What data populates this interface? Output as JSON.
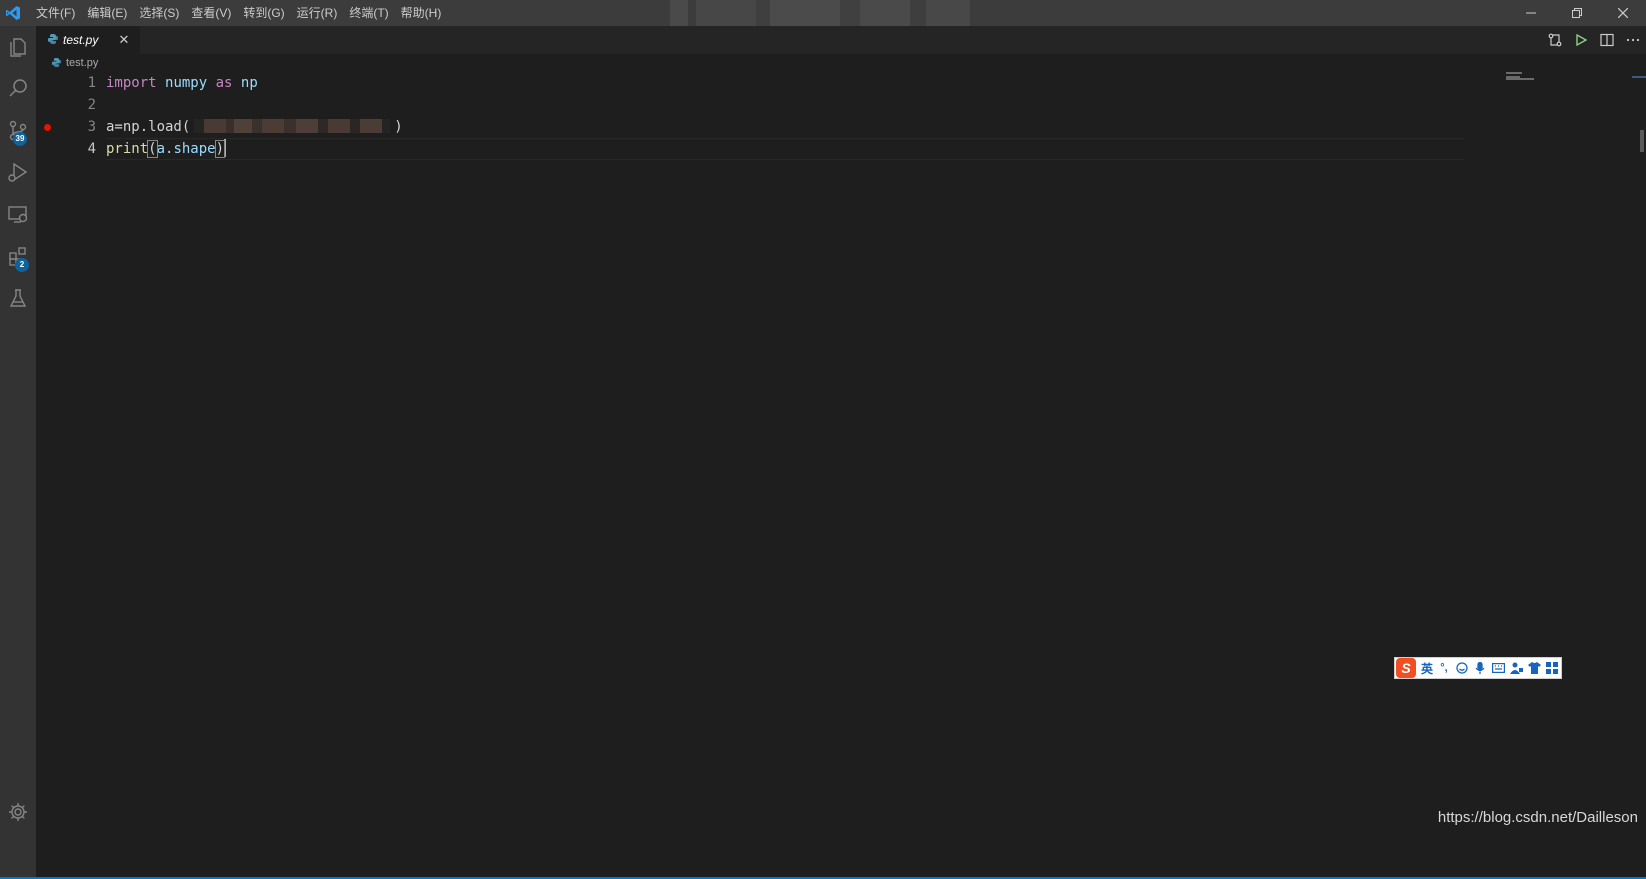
{
  "titlebar": {
    "menu": [
      "文件(F)",
      "编辑(E)",
      "选择(S)",
      "查看(V)",
      "转到(G)",
      "运行(R)",
      "终端(T)",
      "帮助(H)"
    ],
    "window_controls": [
      "minimize-icon",
      "restore-icon",
      "close-icon"
    ]
  },
  "activitybar": {
    "items": [
      {
        "icon": "explorer-icon"
      },
      {
        "icon": "search-icon"
      },
      {
        "icon": "source-control-icon",
        "badge": "39"
      },
      {
        "icon": "run-debug-icon"
      },
      {
        "icon": "remote-explorer-icon"
      },
      {
        "icon": "extensions-icon",
        "badge": "2"
      },
      {
        "icon": "testing-icon"
      }
    ],
    "bottom": {
      "icon": "settings-gear-icon"
    }
  },
  "tabs": [
    {
      "label": "test.py",
      "active": true,
      "italic": true
    }
  ],
  "editor_actions": [
    "compare-changes-icon",
    "run-python-icon",
    "split-editor-icon",
    "more-actions-icon"
  ],
  "breadcrumb": {
    "file": "test.py"
  },
  "editor": {
    "language": "python",
    "lines": [
      {
        "number": "1",
        "text": "import numpy as np"
      },
      {
        "number": "2",
        "text": ""
      },
      {
        "number": "3",
        "text": "a=np.load( [redacted] )",
        "breakpoint": true,
        "prefix": "a=np.load(",
        "suffix": ")"
      },
      {
        "number": "4",
        "text": "print(a.shape)",
        "active": true
      }
    ],
    "tokens": {
      "import": "import",
      "numpy": "numpy",
      "as": "as",
      "np": "np",
      "print": "print",
      "open_paren": "(",
      "arg": "a.shape",
      "close_paren": ")"
    }
  },
  "ime_toolbar": {
    "lang": "英"
  },
  "watermark": "https://blog.csdn.net/Dailleson",
  "colors": {
    "keyword": "#c586c0",
    "function": "#dcdcaa",
    "breakpoint": "#e51400",
    "run_icon": "#89d185",
    "vscode_blue": "#0078d4"
  }
}
